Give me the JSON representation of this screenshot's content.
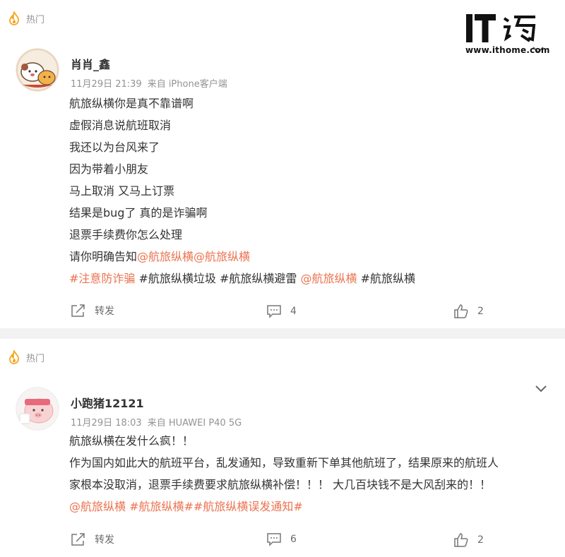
{
  "watermark": {
    "logo_text": "IT之家",
    "url": "www.ithome.com"
  },
  "posts": [
    {
      "badge": "热门",
      "username": "肖肖_鑫",
      "date": "11月29日 21:39",
      "source": "来自 iPhone客户端",
      "lines": [
        "航旅纵横你是真不靠谱啊",
        "虚假消息说航班取消",
        "我还以为台风来了",
        "因为带着小朋友",
        "马上取消 又马上订票",
        "结果是bug了 真的是诈骗啊",
        "退票手续费你怎么处理"
      ],
      "line8_text": "请你明确告知",
      "line8_mention1": "@航旅纵横",
      "line8_mention2": "@航旅纵横",
      "tags": {
        "t1": "#注意防诈骗",
        "t2": " #航旅纵横垃圾 #航旅纵横避雷 ",
        "t3": "@航旅纵横",
        "t4": " #航旅纵横"
      },
      "actions": {
        "repost": "转发",
        "comments": "4",
        "likes": "2"
      }
    },
    {
      "badge": "热门",
      "username": "小跑猪12121",
      "date": "11月29日 18:03",
      "source": "来自 HUAWEI P40 5G",
      "lines": [
        "航旅纵横在发什么疯！！",
        "作为国内如此大的航班平台，乱发通知，导致重新下单其他航班了，结果原来的航班人",
        "家根本没取消，退票手续费要求航旅纵横补偿！！！ 大几百块钱不是大风刮来的！！"
      ],
      "tags": {
        "t1": "@航旅纵横",
        "t2": " ",
        "t3": "#航旅纵横##航旅纵横误发通知#"
      },
      "actions": {
        "repost": "转发",
        "comments": "6",
        "likes": "2"
      }
    }
  ],
  "colors": {
    "link": "#eb7350",
    "text": "#333333",
    "meta": "#939393",
    "flame": "#f5a623"
  }
}
